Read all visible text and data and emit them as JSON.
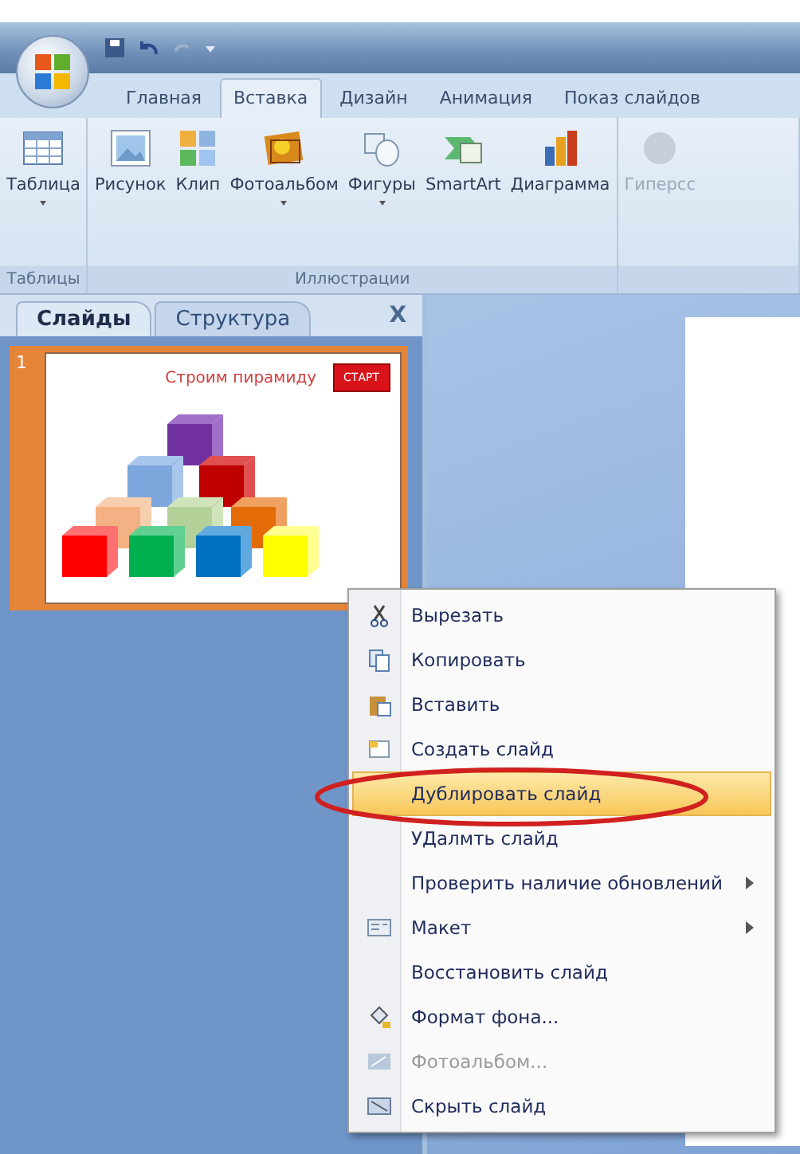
{
  "tabs": [
    {
      "label": "Главная",
      "selected": false
    },
    {
      "label": "Вставка",
      "selected": true
    },
    {
      "label": "Дизайн",
      "selected": false
    },
    {
      "label": "Анимация",
      "selected": false
    },
    {
      "label": "Показ слайдов",
      "selected": false
    }
  ],
  "ribbon_groups": [
    {
      "name": "Таблицы",
      "buttons": [
        {
          "label": "Таблица",
          "dropdown": true,
          "disabled": false
        }
      ]
    },
    {
      "name": "Иллюстрации",
      "buttons": [
        {
          "label": "Рисунок",
          "dropdown": false,
          "disabled": false
        },
        {
          "label": "Клип",
          "dropdown": false,
          "disabled": false
        },
        {
          "label": "Фотоальбом",
          "dropdown": true,
          "disabled": false
        },
        {
          "label": "Фигуры",
          "dropdown": true,
          "disabled": false
        },
        {
          "label": "SmartArt",
          "dropdown": false,
          "disabled": false
        },
        {
          "label": "Диаграмма",
          "dropdown": false,
          "disabled": false
        }
      ]
    },
    {
      "buttons": [
        {
          "label": "Гиперсс",
          "dropdown": false,
          "disabled": true
        }
      ]
    }
  ],
  "panel": {
    "tabs": [
      {
        "label": "Слайды",
        "selected": true
      },
      {
        "label": "Структура",
        "selected": false
      }
    ],
    "close": "X"
  },
  "slides": [
    {
      "number": "1",
      "title": "Строим пирамиду",
      "button": "СТАРТ",
      "selected": true
    }
  ],
  "context_menu": [
    {
      "label": "Вырезать",
      "kind": "item",
      "highlighted": false,
      "disabled": false
    },
    {
      "label": "Копировать",
      "kind": "item",
      "highlighted": false,
      "disabled": false
    },
    {
      "label": "Вставить",
      "kind": "item",
      "highlighted": false,
      "disabled": false
    },
    {
      "label": "Создать слайд",
      "kind": "item",
      "highlighted": false,
      "disabled": false
    },
    {
      "label": "Дублировать слайд",
      "kind": "item",
      "highlighted": true,
      "disabled": false
    },
    {
      "label": "УДалмть слайд",
      "kind": "item",
      "highlighted": false,
      "disabled": false
    },
    {
      "label": "Проверить наличие обновлений",
      "kind": "submenu",
      "highlighted": false,
      "disabled": false
    },
    {
      "label": "Макет",
      "kind": "submenu",
      "highlighted": false,
      "disabled": false
    },
    {
      "label": "Восстановить слайд",
      "kind": "item",
      "highlighted": false,
      "disabled": false
    },
    {
      "label": "Формат фона...",
      "kind": "item",
      "highlighted": false,
      "disabled": false
    },
    {
      "label": "Фотоальбом...",
      "kind": "item",
      "highlighted": false,
      "disabled": true
    },
    {
      "label": "Скрыть слайд",
      "kind": "item",
      "highlighted": false,
      "disabled": false
    }
  ]
}
